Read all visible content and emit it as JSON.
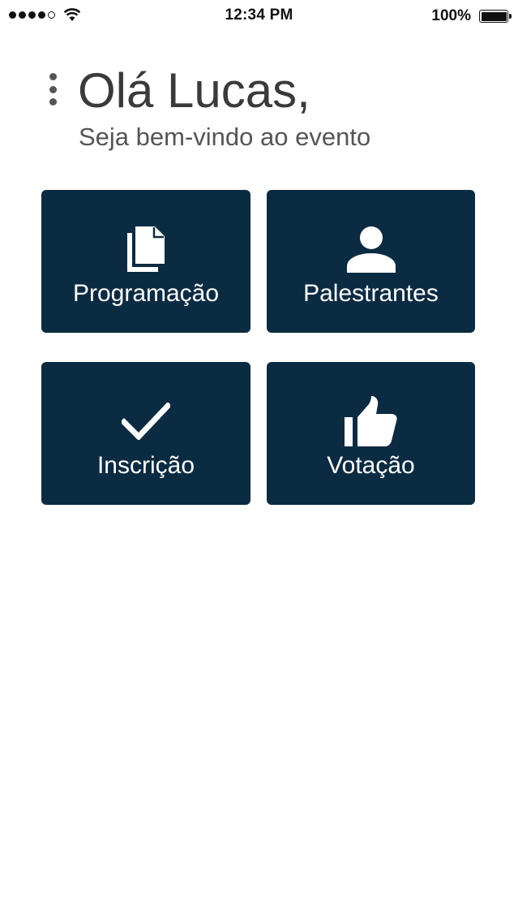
{
  "status_bar": {
    "time": "12:34 PM",
    "battery": "100%",
    "signal_bars": 4
  },
  "header": {
    "greeting": "Olá Lucas,",
    "subtitle": "Seja bem-vindo ao evento",
    "menu_icon": "more-vertical-icon"
  },
  "tiles": [
    {
      "label": "Programação",
      "icon": "documents-icon"
    },
    {
      "label": "Palestrantes",
      "icon": "person-icon"
    },
    {
      "label": "Inscrição",
      "icon": "checkmark-icon"
    },
    {
      "label": "Votação",
      "icon": "thumbs-up-icon"
    }
  ],
  "colors": {
    "tile_background": "#0b2b42",
    "tile_text": "#ffffff",
    "greeting_text": "#3a3a3a",
    "background": "#ffffff"
  }
}
